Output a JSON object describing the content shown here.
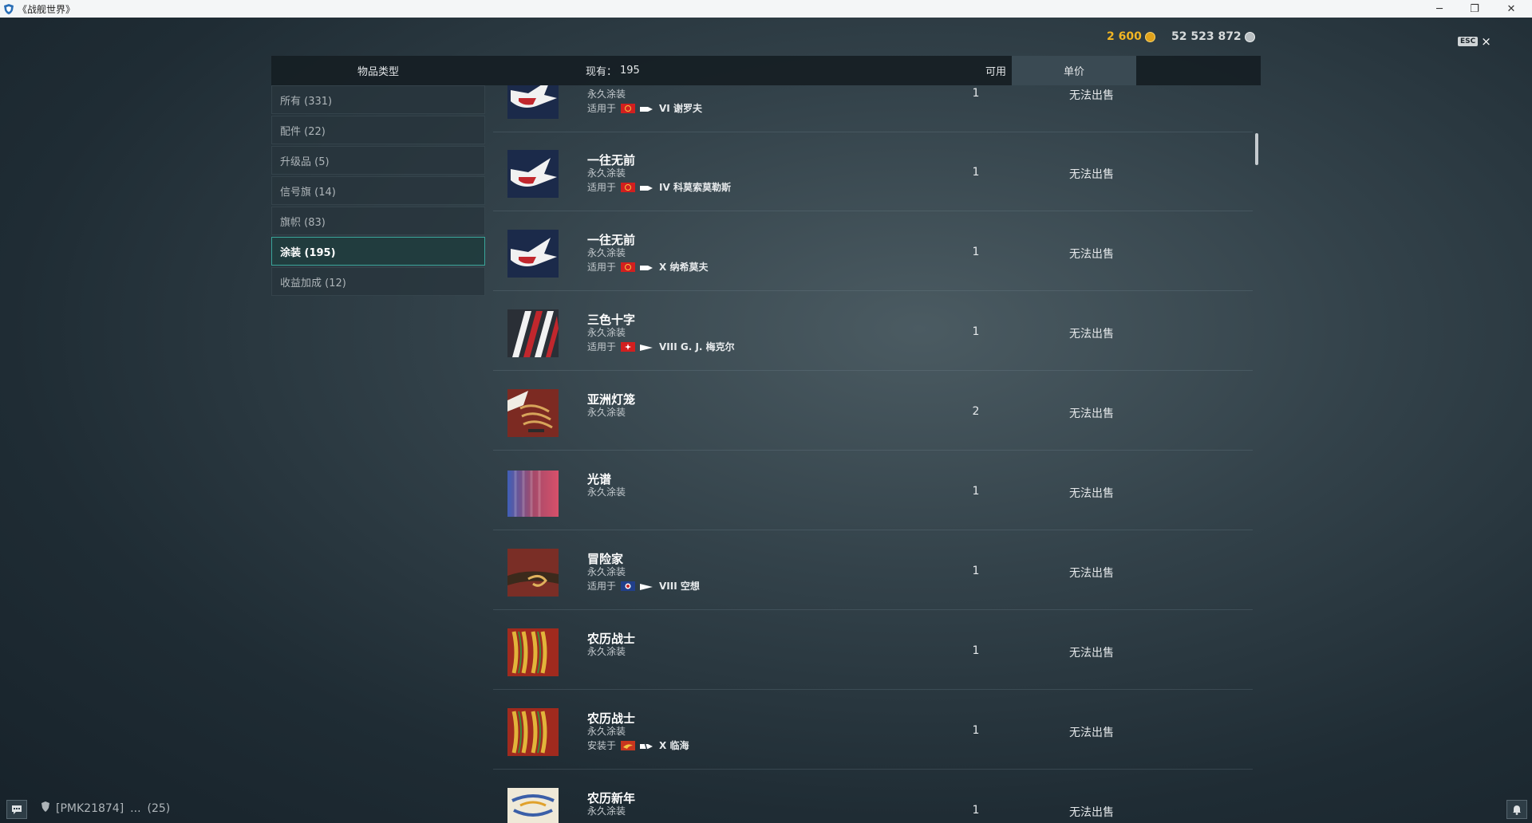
{
  "window": {
    "title": "《战舰世界》"
  },
  "currency": {
    "gold": "2 600",
    "silver": "52 523 872",
    "gold_color": "#f1b523",
    "silver_color": "#d7dbdc"
  },
  "esc": {
    "key": "ESC",
    "close": "×"
  },
  "header": {
    "category": "物品类型",
    "count_label": "现有：",
    "count_value": "195",
    "available": "可用",
    "unit_price": "单价"
  },
  "sidebar": {
    "items": [
      {
        "label": "所有 (331)",
        "active": false
      },
      {
        "label": "配件 (22)",
        "active": false
      },
      {
        "label": "升级品 (5)",
        "active": false
      },
      {
        "label": "信号旗 (14)",
        "active": false
      },
      {
        "label": "旗帜 (83)",
        "active": false
      },
      {
        "label": "涂装 (195)",
        "active": true
      },
      {
        "label": "收益加成 (12)",
        "active": false
      }
    ]
  },
  "rows": [
    {
      "name": "",
      "subtype": "永久涂装",
      "applies_label": "适用于",
      "ship": "VI 谢罗夫",
      "qty": "1",
      "price": "无法出售",
      "icon": "swallow-camo-icon",
      "flag": "ussr-flag-icon",
      "class": "destroyer-icon"
    },
    {
      "name": "一往无前",
      "subtype": "永久涂装",
      "applies_label": "适用于",
      "ship": "IV 科莫索莫勒斯",
      "qty": "1",
      "price": "无法出售",
      "icon": "swallow-camo-icon",
      "flag": "ussr-flag-icon",
      "class": "destroyer-icon"
    },
    {
      "name": "一往无前",
      "subtype": "永久涂装",
      "applies_label": "适用于",
      "ship": "X 纳希莫夫",
      "qty": "1",
      "price": "无法出售",
      "icon": "swallow-camo-icon",
      "flag": "ussr-flag-icon",
      "class": "destroyer-icon"
    },
    {
      "name": "三色十字",
      "subtype": "永久涂装",
      "applies_label": "适用于",
      "ship": "VIII G. J. 梅克尔",
      "qty": "1",
      "price": "无法出售",
      "icon": "stripes-camo-icon",
      "flag": "netherlands-flag-icon",
      "class": "cruiser-icon"
    },
    {
      "name": "亚洲灯笼",
      "subtype": "永久涂装",
      "applies_label": "",
      "ship": "",
      "qty": "2",
      "price": "无法出售",
      "icon": "lantern-camo-icon",
      "flag": "",
      "class": ""
    },
    {
      "name": "光谱",
      "subtype": "永久涂装",
      "applies_label": "",
      "ship": "",
      "qty": "1",
      "price": "无法出售",
      "icon": "spectrum-camo-icon",
      "flag": "",
      "class": ""
    },
    {
      "name": "冒险家",
      "subtype": "永久涂装",
      "applies_label": "适用于",
      "ship": "VIII 空想",
      "qty": "1",
      "price": "无法出售",
      "icon": "adventurer-camo-icon",
      "flag": "uk-flag-icon",
      "class": "cruiser-icon"
    },
    {
      "name": "农历战士",
      "subtype": "永久涂装",
      "applies_label": "",
      "ship": "",
      "qty": "1",
      "price": "无法出售",
      "icon": "lunar-warrior-camo-icon",
      "flag": "",
      "class": ""
    },
    {
      "name": "农历战士",
      "subtype": "永久涂装",
      "applies_label": "安装于",
      "ship": "X 临海",
      "qty": "1",
      "price": "无法出售",
      "icon": "lunar-warrior-camo-icon",
      "flag": "panasia-flag-icon",
      "class": "destroyer-icon"
    },
    {
      "name": "农历新年",
      "subtype": "永久涂装",
      "applies_label": "",
      "ship": "",
      "qty": "1",
      "price": "无法出售",
      "icon": "lunar-newyear-camo-icon",
      "flag": "",
      "class": ""
    }
  ],
  "footer": {
    "clan": "[PMK21874]",
    "ellipsis": "...",
    "count": "(25)"
  }
}
